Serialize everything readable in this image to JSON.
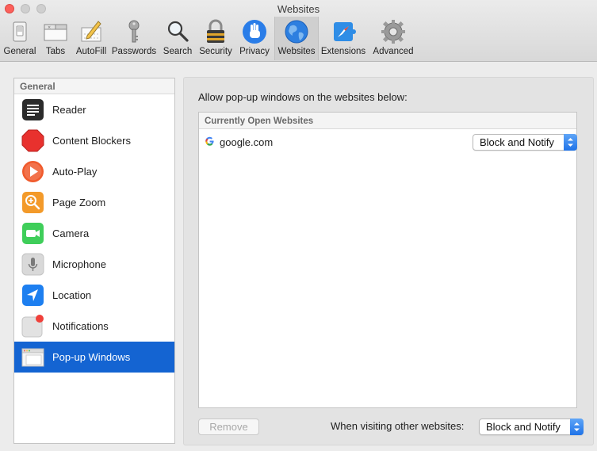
{
  "window": {
    "title": "Websites"
  },
  "toolbar": {
    "items": [
      {
        "label": "General",
        "icon": "general-switch-icon"
      },
      {
        "label": "Tabs",
        "icon": "tabs-icon"
      },
      {
        "label": "AutoFill",
        "icon": "autofill-pencil-icon"
      },
      {
        "label": "Passwords",
        "icon": "key-icon"
      },
      {
        "label": "Search",
        "icon": "magnifier-icon"
      },
      {
        "label": "Security",
        "icon": "padlock-icon"
      },
      {
        "label": "Privacy",
        "icon": "hand-icon"
      },
      {
        "label": "Websites",
        "icon": "globe-icon",
        "selected": true
      },
      {
        "label": "Extensions",
        "icon": "puzzle-compass-icon"
      },
      {
        "label": "Advanced",
        "icon": "gear-icon"
      }
    ]
  },
  "sidebar": {
    "header": "General",
    "items": [
      {
        "label": "Reader",
        "icon": "reader-icon"
      },
      {
        "label": "Content Blockers",
        "icon": "stop-sign-icon"
      },
      {
        "label": "Auto-Play",
        "icon": "play-icon"
      },
      {
        "label": "Page Zoom",
        "icon": "zoom-icon"
      },
      {
        "label": "Camera",
        "icon": "camera-icon"
      },
      {
        "label": "Microphone",
        "icon": "microphone-icon"
      },
      {
        "label": "Location",
        "icon": "location-arrow-icon"
      },
      {
        "label": "Notifications",
        "icon": "notifications-icon"
      },
      {
        "label": "Pop-up Windows",
        "icon": "popup-window-icon",
        "selected": true
      }
    ]
  },
  "main": {
    "description": "Allow pop-up windows on the websites below:",
    "table_header": "Currently Open Websites",
    "rows": [
      {
        "site": "google.com",
        "icon": "google-g-icon",
        "setting": "Block and Notify"
      }
    ],
    "remove_label": "Remove",
    "other_websites_label": "When visiting other websites:",
    "other_websites_setting": "Block and Notify"
  },
  "colors": {
    "selection": "#1464d2",
    "popup_arrow": "#1f73e8",
    "close_button": "#fc605b"
  }
}
